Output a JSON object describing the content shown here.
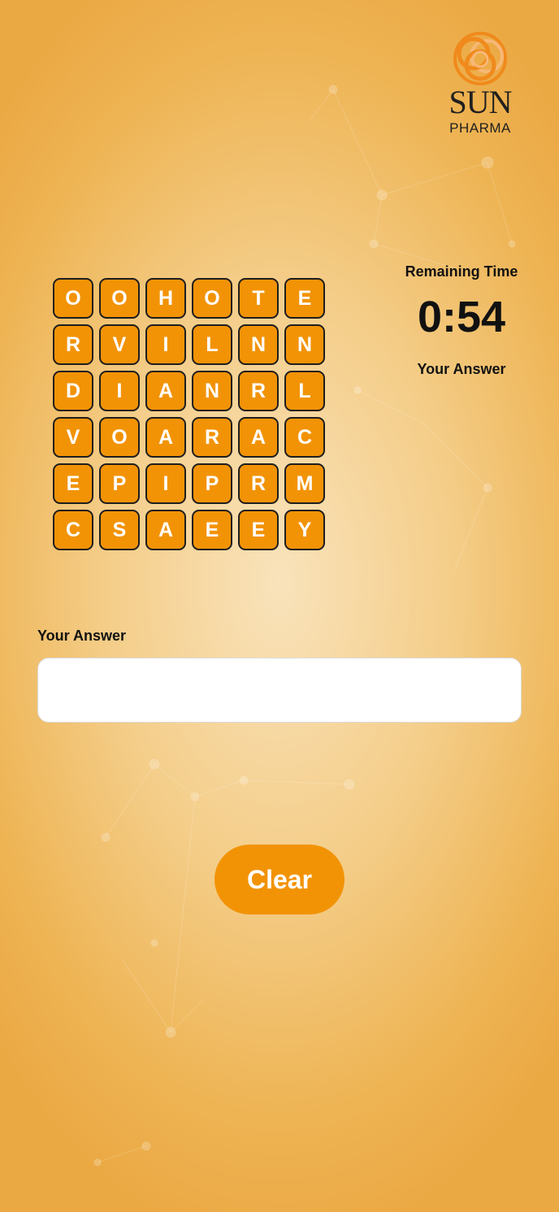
{
  "brand": {
    "line1": "SUN",
    "line2": "PHARMA",
    "logo_icon": "sun-pharma-swirl-icon",
    "logo_colors": [
      "#f08a1c",
      "#f7b877"
    ]
  },
  "puzzle": {
    "rows": [
      [
        "O",
        "O",
        "H",
        "O",
        "T",
        "E"
      ],
      [
        "R",
        "V",
        "I",
        "L",
        "N",
        "N"
      ],
      [
        "D",
        "I",
        "A",
        "N",
        "R",
        "L"
      ],
      [
        "V",
        "O",
        "A",
        "R",
        "A",
        "C"
      ],
      [
        "E",
        "P",
        "I",
        "P",
        "R",
        "M"
      ],
      [
        "C",
        "S",
        "A",
        "E",
        "E",
        "Y"
      ]
    ]
  },
  "timer": {
    "label": "Remaining Time",
    "value": "0:54"
  },
  "side_answer": {
    "label": "Your Answer",
    "value": ""
  },
  "answer": {
    "label": "Your Answer",
    "value": "",
    "placeholder": ""
  },
  "actions": {
    "clear_label": "Clear"
  },
  "colors": {
    "tile": "#f29306",
    "button": "#f29306",
    "background": "#f4cd88"
  }
}
